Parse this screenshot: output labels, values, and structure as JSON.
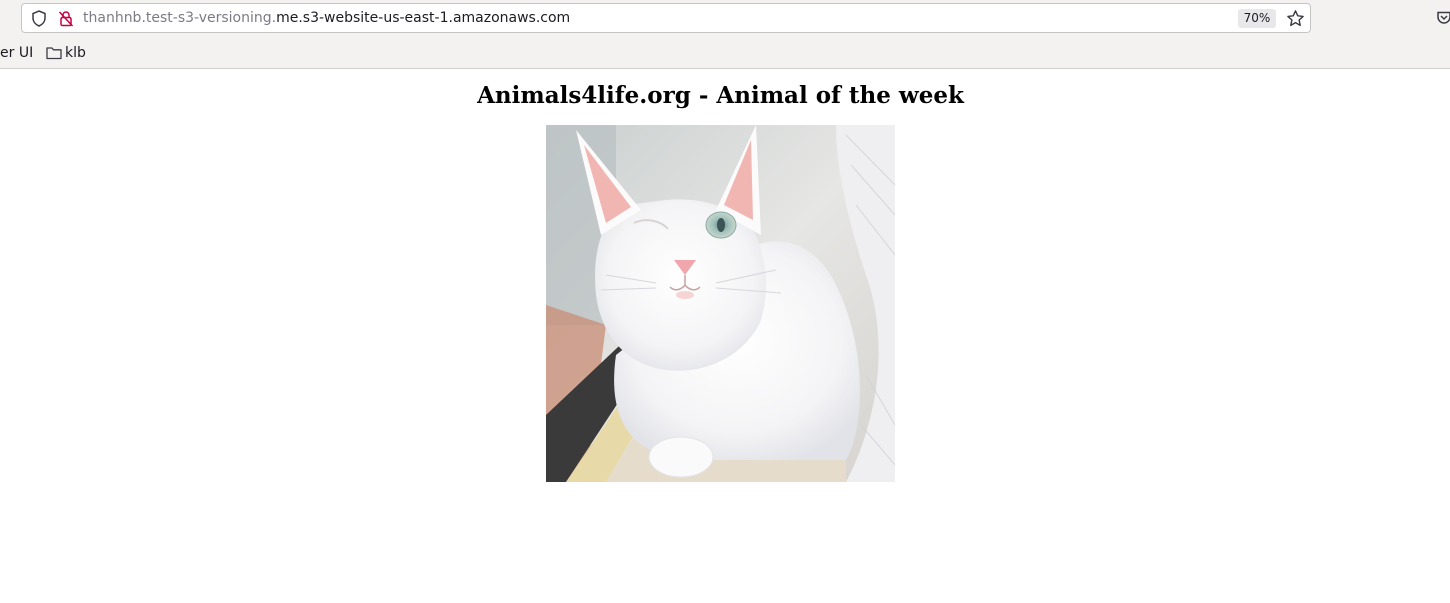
{
  "browser": {
    "url_host_dim": "thanhnb.test-s3-versioning.",
    "url_host_main": "me.s3-website-us-east-1.amazonaws.com",
    "zoom_level": "70%",
    "bookmarks": [
      {
        "label": "er UI",
        "type": "partial"
      },
      {
        "label": "klb",
        "type": "folder"
      }
    ]
  },
  "page": {
    "title": "Animals4life.org - Animal of the week",
    "image_alt": "white cat"
  },
  "colors": {
    "chrome_bg": "#f3f2f0",
    "lock_warning": "#c50042"
  },
  "icons": [
    "shield-icon",
    "lock-icon",
    "star-icon",
    "pocket-icon",
    "folder-icon"
  ]
}
